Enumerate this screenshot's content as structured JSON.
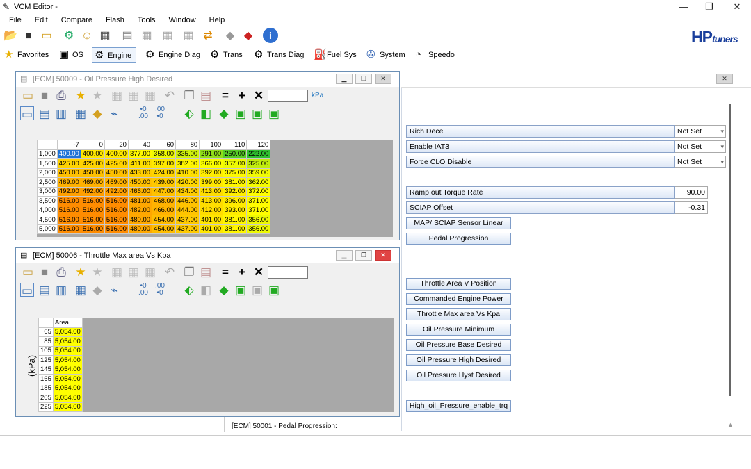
{
  "app": {
    "title": "VCM Editor -",
    "logo": "HPtuners",
    "logo_hp": "HP",
    "logo_tuners": "tuners"
  },
  "window_controls": {
    "minimize": "—",
    "maximize": "❐",
    "close": "✕"
  },
  "menu": [
    "File",
    "Edit",
    "Compare",
    "Flash",
    "Tools",
    "Window",
    "Help"
  ],
  "tabs": [
    {
      "label": "Favorites",
      "icon": "star-icon"
    },
    {
      "label": "OS",
      "icon": "chip-icon"
    },
    {
      "label": "Engine",
      "icon": "engine-icon"
    },
    {
      "label": "Engine Diag",
      "icon": "engine-diag-icon"
    },
    {
      "label": "Trans",
      "icon": "gear-icon"
    },
    {
      "label": "Trans Diag",
      "icon": "gear-diag-icon"
    },
    {
      "label": "Fuel Sys",
      "icon": "fuel-pump-icon"
    },
    {
      "label": "System",
      "icon": "fan-icon"
    },
    {
      "label": "Speedo",
      "icon": "speedometer-icon"
    }
  ],
  "table1": {
    "title": "[ECM] 50009 - Oil Pressure High Desired",
    "unit": "kPa",
    "columns": [
      "-7",
      "0",
      "20",
      "40",
      "60",
      "80",
      "100",
      "110",
      "120"
    ],
    "rows": [
      {
        "rpm": "1,000",
        "cells": [
          "400.00",
          "400.00",
          "400.00",
          "377.00",
          "358.00",
          "335.00",
          "291.00",
          "250.00",
          "222.00"
        ]
      },
      {
        "rpm": "1,500",
        "cells": [
          "425.00",
          "425.00",
          "425.00",
          "411.00",
          "397.00",
          "382.00",
          "366.00",
          "357.00",
          "325.00"
        ]
      },
      {
        "rpm": "2,000",
        "cells": [
          "450.00",
          "450.00",
          "450.00",
          "433.00",
          "424.00",
          "410.00",
          "392.00",
          "375.00",
          "359.00"
        ]
      },
      {
        "rpm": "2,500",
        "cells": [
          "469.00",
          "469.00",
          "469.00",
          "450.00",
          "439.00",
          "420.00",
          "399.00",
          "381.00",
          "362.00"
        ]
      },
      {
        "rpm": "3,000",
        "cells": [
          "492.00",
          "492.00",
          "492.00",
          "466.00",
          "447.00",
          "434.00",
          "413.00",
          "392.00",
          "372.00"
        ]
      },
      {
        "rpm": "3,500",
        "cells": [
          "516.00",
          "516.00",
          "516.00",
          "481.00",
          "468.00",
          "446.00",
          "413.00",
          "396.00",
          "371.00"
        ]
      },
      {
        "rpm": "4,000",
        "cells": [
          "516.00",
          "516.00",
          "516.00",
          "482.00",
          "466.00",
          "444.00",
          "412.00",
          "393.00",
          "371.00"
        ]
      },
      {
        "rpm": "4,500",
        "cells": [
          "516.00",
          "516.00",
          "516.00",
          "480.00",
          "454.00",
          "437.00",
          "401.00",
          "381.00",
          "356.00"
        ]
      },
      {
        "rpm": "5,000",
        "cells": [
          "516.00",
          "516.00",
          "516.00",
          "480.00",
          "454.00",
          "437.00",
          "401.00",
          "381.00",
          "356.00"
        ]
      }
    ],
    "selected_color": "#1e73d8",
    "color_scale": [
      "#2fc02f",
      "#ffff00",
      "#ff8c00"
    ]
  },
  "table2": {
    "title": "[ECM] 50006 - Throttle Max area Vs Kpa",
    "column": "Area",
    "axis_label": "(kPa)",
    "rows": [
      {
        "kpa": "65",
        "value": "5,054.00"
      },
      {
        "kpa": "85",
        "value": "5,054.00"
      },
      {
        "kpa": "105",
        "value": "5,054.00"
      },
      {
        "kpa": "125",
        "value": "5,054.00"
      },
      {
        "kpa": "145",
        "value": "5,054.00"
      },
      {
        "kpa": "165",
        "value": "5,054.00"
      },
      {
        "kpa": "185",
        "value": "5,054.00"
      },
      {
        "kpa": "205",
        "value": "5,054.00"
      },
      {
        "kpa": "225",
        "value": "5,054.00"
      }
    ]
  },
  "right_panel": {
    "switches": [
      {
        "label": "Rich Decel",
        "value": "Not Set"
      },
      {
        "label": "Enable IAT3",
        "value": "Not Set"
      },
      {
        "label": "Force CLO Disable",
        "value": "Not Set"
      }
    ],
    "params": [
      {
        "label": "Ramp out Torque Rate",
        "value": "90.00"
      },
      {
        "label": "SCIAP Offset",
        "value": "-0.31"
      }
    ],
    "buttons_a": [
      "MAP/ SCIAP Sensor Linear",
      "Pedal Progression"
    ],
    "buttons_b": [
      "Throttle Area V Position",
      "Commanded Engine Power",
      "Throttle Max area Vs Kpa",
      "Oil Pressure Minimum",
      "Oil Pressure Base Desired",
      "Oil Pressure High Desired",
      "Oil Pressure Hyst Desired"
    ],
    "buttons_c": [
      "High_oil_Pressure_enable_trq"
    ]
  },
  "status": {
    "text": "[ECM] 50001 - Pedal Progression:"
  }
}
